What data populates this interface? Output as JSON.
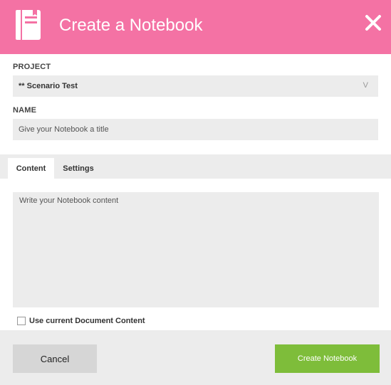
{
  "dialog": {
    "title": "Create a Notebook",
    "header_color": "#f472a4",
    "header_icon": "notebook-icon",
    "close_icon": "close-icon"
  },
  "project": {
    "label": "PROJECT",
    "selected": "** Scenario Test",
    "chevron": "V"
  },
  "name": {
    "label": "NAME",
    "placeholder": "Give your Notebook a title"
  },
  "tabs": [
    {
      "label": "Content",
      "active": true
    },
    {
      "label": "Settings",
      "active": false
    }
  ],
  "content": {
    "placeholder": "Write your Notebook content"
  },
  "checkbox": {
    "label": "Use current Document Content",
    "checked": false
  },
  "footer": {
    "cancel_label": "Cancel",
    "create_label": "Create Notebook",
    "create_color": "#7ebd3a"
  }
}
